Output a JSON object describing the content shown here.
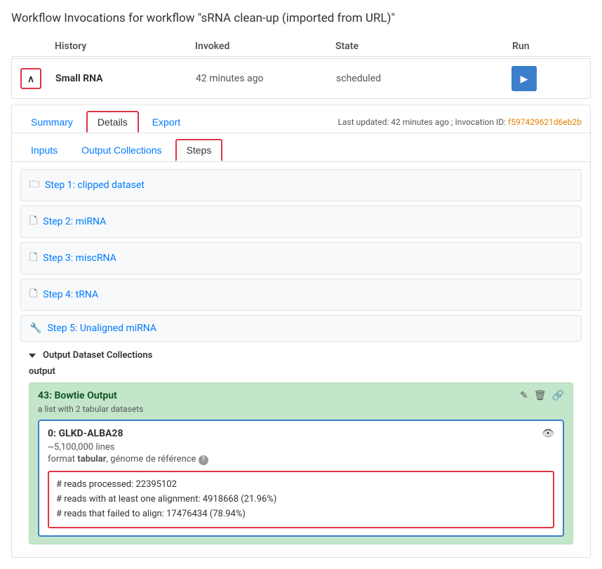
{
  "page": {
    "title": "Workflow Invocations for workflow \"sRNA clean-up (imported from URL)\""
  },
  "table": {
    "columns": [
      "",
      "History",
      "Invoked",
      "",
      "State",
      "Run"
    ],
    "row": {
      "history_name": "Small RNA",
      "invoked": "42 minutes ago",
      "state": "scheduled"
    }
  },
  "detail": {
    "last_updated": "Last updated: 42 minutes ago ; Invocation ID: ",
    "invocation_id": "f597429621d6eb2b",
    "tabs": {
      "summary": "Summary",
      "details": "Details",
      "export": "Export"
    },
    "sub_tabs": {
      "inputs": "Inputs",
      "output_collections": "Output Collections",
      "steps": "Steps"
    },
    "steps": [
      {
        "id": 1,
        "label": "Step 1: clipped dataset",
        "type": "collection"
      },
      {
        "id": 2,
        "label": "Step 2: miRNA",
        "type": "file"
      },
      {
        "id": 3,
        "label": "Step 3: miscRNA",
        "type": "file"
      },
      {
        "id": 4,
        "label": "Step 4: tRNA",
        "type": "file"
      },
      {
        "id": 5,
        "label": "Step 5: Unaligned miRNA",
        "type": "tool"
      }
    ],
    "output_collections_header": "Output Dataset Collections",
    "output_label": "output",
    "collection": {
      "title": "43: Bowtie Output",
      "meta": "a list with 2 tabular datasets"
    },
    "dataset": {
      "title": "0: GLKD-ALBA28",
      "lines": "~5,100,000 lines",
      "format_label": "format",
      "format_value": "tabular",
      "genome_label": "génome de référence",
      "stats": [
        "# reads processed: 22395102",
        "# reads with at least one alignment: 4918668 (21.96%)",
        "# reads that failed to align: 17476434 (78.94%)"
      ]
    }
  },
  "icons": {
    "collapse": "∧",
    "play": "▶",
    "collection_icon": "🗀",
    "file_icon": "🗋",
    "tool_icon": "🔧",
    "pencil": "✎",
    "trash": "🗑",
    "link": "🔗",
    "eye": "👁"
  }
}
